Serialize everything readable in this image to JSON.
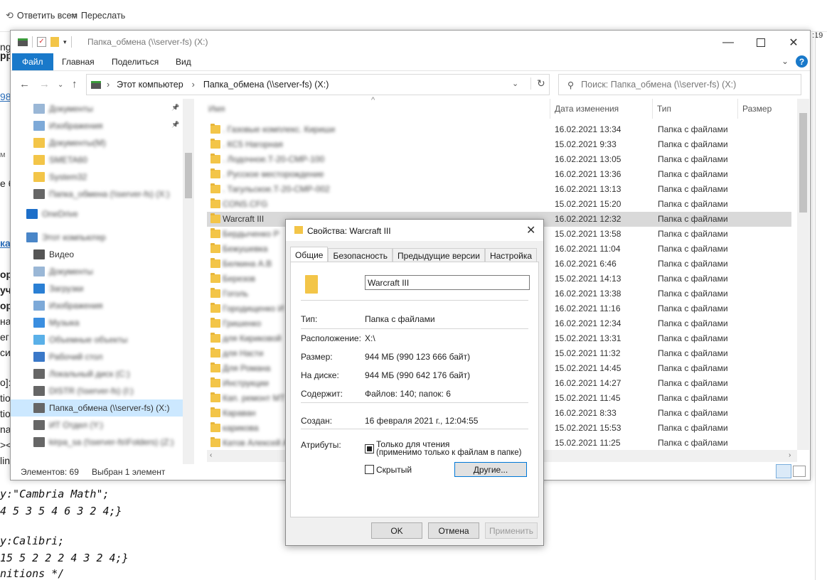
{
  "mail": {
    "reply_all": "Ответить всем",
    "forward": "Переслать",
    "time_partial": ":19",
    "left_fragments": [
      "ng",
      "pp",
      "98",
      "м",
      "е б",
      "ка",
      "ор",
      "уч",
      "ор",
      "на",
      "ег",
      "си",
      "o]:",
      "tio",
      "tio",
      "na",
      "><",
      "lin"
    ],
    "code_lines": [
      "y:\"Cambria Math\";",
      " 4 5 3 5 4 6 3 2 4;}",
      "",
      "y:Calibri;",
      " 15 5 2 2 2 4 3 2 4;}",
      "nitions */"
    ]
  },
  "explorer": {
    "title": "Папка_обмена (\\\\server-fs) (X:)",
    "ribbon_tabs": [
      "Файл",
      "Главная",
      "Поделиться",
      "Вид"
    ],
    "address": {
      "crumbs": [
        "Этот компьютер",
        "Папка_обмена (\\\\server-fs) (X:)"
      ]
    },
    "search_placeholder": "Поиск: Папка_обмена (\\\\server-fs) (X:)",
    "nav_items": [
      {
        "label": "Документы",
        "blurred": true,
        "pinned": true,
        "icon": "doc-icon"
      },
      {
        "label": "Изображения",
        "blurred": true,
        "pinned": true,
        "icon": "image-icon"
      },
      {
        "label": "Документы(M)",
        "blurred": true,
        "icon": "folder-icon"
      },
      {
        "label": "SMETA60",
        "blurred": true,
        "icon": "folder-icon"
      },
      {
        "label": "System32",
        "blurred": true,
        "icon": "folder-icon"
      },
      {
        "label": "Папка_обмена (\\\\server-fs) (X:)",
        "blurred": true,
        "icon": "drive-icon"
      },
      {
        "label": "OneDrive",
        "blurred": true,
        "icon": "cloud-icon"
      },
      {
        "label": "Этот компьютер",
        "blurred": true,
        "icon": "computer-icon"
      },
      {
        "label": "Видео",
        "blurred": false,
        "icon": "video-icon"
      },
      {
        "label": "Документы",
        "blurred": true,
        "icon": "doc-icon"
      },
      {
        "label": "Загрузки",
        "blurred": true,
        "icon": "download-icon"
      },
      {
        "label": "Изображения",
        "blurred": true,
        "icon": "image-icon"
      },
      {
        "label": "Музыка",
        "blurred": true,
        "icon": "music-icon"
      },
      {
        "label": "Объемные объекты",
        "blurred": true,
        "icon": "cube-icon"
      },
      {
        "label": "Рабочий стол",
        "blurred": true,
        "icon": "desktop-icon"
      },
      {
        "label": "Локальный диск (C:)",
        "blurred": true,
        "icon": "drive-icon"
      },
      {
        "label": "DISTR (\\\\server-fs) (I:)",
        "blurred": true,
        "icon": "drive-icon"
      },
      {
        "label": "Папка_обмена (\\\\server-fs) (X:)",
        "blurred": false,
        "selected": true,
        "icon": "drive-icon"
      },
      {
        "label": "ИТ Отдел (Y:)",
        "blurred": true,
        "icon": "drive-icon"
      },
      {
        "label": "kirpa_sa (\\\\server-fs\\Folders) (Z:)",
        "blurred": true,
        "icon": "drive-icon"
      }
    ],
    "columns": [
      "Имя",
      "Дата изменения",
      "Тип",
      "Размер"
    ],
    "files": [
      {
        "name": ". Газовые комплекс. Кириши",
        "date": "16.02.2021 13:34",
        "type": "Папка с файлами",
        "blurred": true
      },
      {
        "name": ". КС5 Нагорная",
        "date": "15.02.2021 9:33",
        "type": "Папка с файлами",
        "blurred": true
      },
      {
        "name": ". Лодочное.Т-20-СМР-100",
        "date": "16.02.2021 13:05",
        "type": "Папка с файлами",
        "blurred": true
      },
      {
        "name": ". Русское месторождение",
        "date": "16.02.2021 13:36",
        "type": "Папка с файлами",
        "blurred": true
      },
      {
        "name": ". Тагульское.Т-20-СМР-002",
        "date": "16.02.2021 13:13",
        "type": "Папка с файлами",
        "blurred": true
      },
      {
        "name": "CONS.CFG",
        "date": "15.02.2021 15:20",
        "type": "Папка с файлами",
        "blurred": true
      },
      {
        "name": "Warcraft III",
        "date": "16.02.2021 12:32",
        "type": "Папка с файлами",
        "blurred": false,
        "selected": true
      },
      {
        "name": "Бердыченко Р",
        "date": "15.02.2021 13:58",
        "type": "Папка с файлами",
        "blurred": true
      },
      {
        "name": "Бежушевка",
        "date": "16.02.2021 11:04",
        "type": "Папка с файлами",
        "blurred": true
      },
      {
        "name": "Белкина А.В",
        "date": "16.02.2021 6:46",
        "type": "Папка с файлами",
        "blurred": true
      },
      {
        "name": "Березов",
        "date": "15.02.2021 14:13",
        "type": "Папка с файлами",
        "blurred": true
      },
      {
        "name": "Гоголь",
        "date": "16.02.2021 13:38",
        "type": "Папка с файлами",
        "blurred": true
      },
      {
        "name": "Городищенко И",
        "date": "16.02.2021 11:16",
        "type": "Папка с файлами",
        "blurred": true
      },
      {
        "name": "Гришенко",
        "date": "16.02.2021 12:34",
        "type": "Папка с файлами",
        "blurred": true
      },
      {
        "name": "для Кириковой",
        "date": "15.02.2021 13:31",
        "type": "Папка с файлами",
        "blurred": true
      },
      {
        "name": "для Насти",
        "date": "15.02.2021 11:32",
        "type": "Папка с файлами",
        "blurred": true
      },
      {
        "name": "Для Романа",
        "date": "15.02.2021 14:45",
        "type": "Папка с файлами",
        "blurred": true
      },
      {
        "name": "Инструкции",
        "date": "16.02.2021 14:27",
        "type": "Папка с файлами",
        "blurred": true
      },
      {
        "name": "Кап. ремонт МТ",
        "date": "15.02.2021 11:45",
        "type": "Папка с файлами",
        "blurred": true
      },
      {
        "name": "Караван",
        "date": "16.02.2021 8:33",
        "type": "Папка с файлами",
        "blurred": true
      },
      {
        "name": "карикова",
        "date": "15.02.2021 15:53",
        "type": "Папка с файлами",
        "blurred": true
      },
      {
        "name": "Катов Алексей А",
        "date": "15.02.2021 11:25",
        "type": "Папка с файлами",
        "blurred": true
      }
    ],
    "status": {
      "count": "Элементов: 69",
      "selected": "Выбран 1 элемент"
    }
  },
  "dialog": {
    "title": "Свойства: Warcraft III",
    "tabs": [
      "Общие",
      "Безопасность",
      "Предыдущие версии",
      "Настройка"
    ],
    "name_value": "Warcraft III",
    "rows": {
      "type": {
        "label": "Тип:",
        "value": "Папка с файлами"
      },
      "location": {
        "label": "Расположение:",
        "value": "X:\\"
      },
      "size": {
        "label": "Размер:",
        "value": "944 МБ (990 123 666 байт)"
      },
      "disk": {
        "label": "На диске:",
        "value": "944 МБ (990 642 176 байт)"
      },
      "contains": {
        "label": "Содержит:",
        "value": "Файлов: 140; папок: 6"
      },
      "created": {
        "label": "Создан:",
        "value": "16 февраля 2021 г., 12:04:55"
      },
      "attrs": {
        "label": "Атрибуты:"
      }
    },
    "readonly_label": "Только для чтения",
    "readonly_note": "(применимо только к файлам в папке)",
    "hidden_label": "Скрытый",
    "other_button": "Другие...",
    "ok": "OK",
    "cancel": "Отмена",
    "apply": "Применить"
  }
}
